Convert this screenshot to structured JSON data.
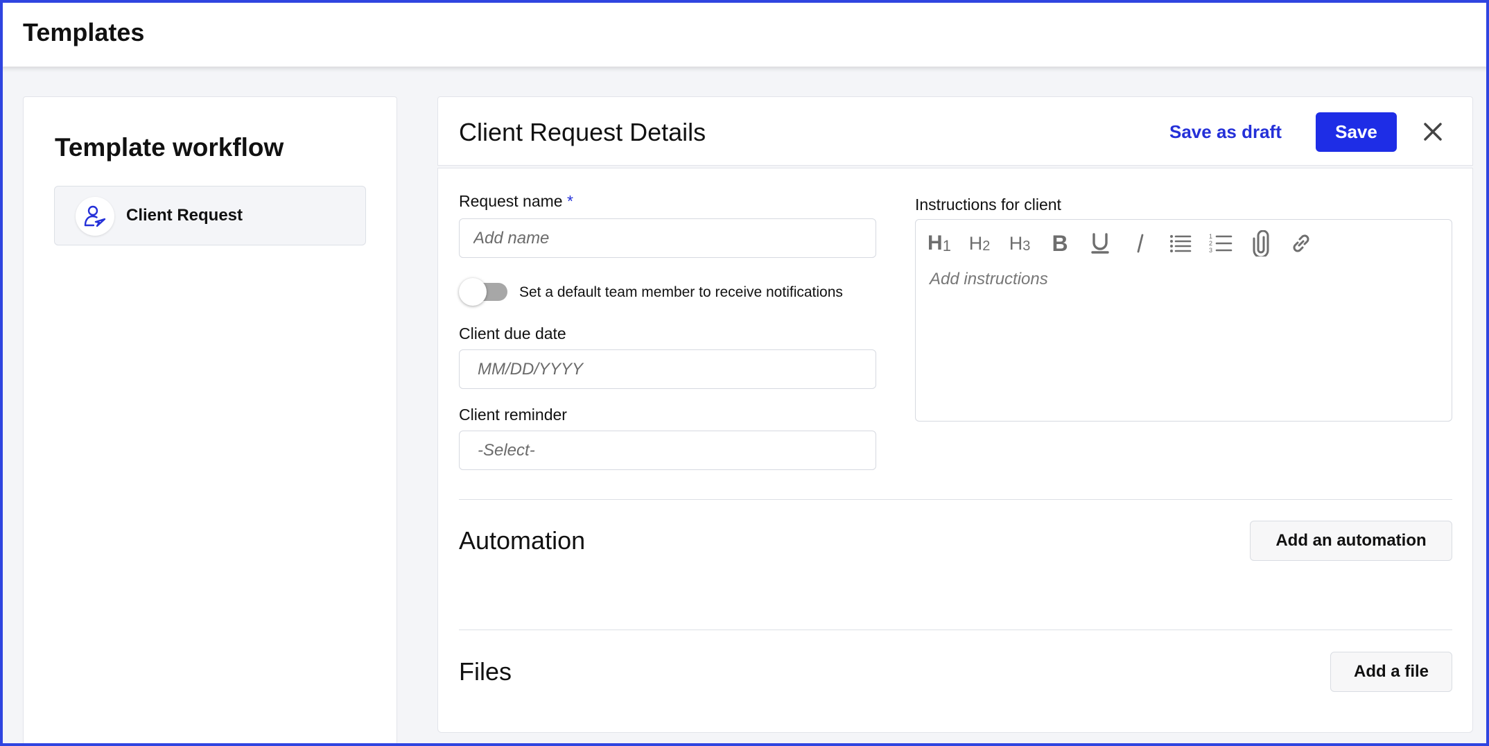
{
  "app": {
    "page_title": "Templates"
  },
  "sidebar": {
    "heading": "Template workflow",
    "items": [
      {
        "label": "Client Request",
        "icon": "user-send-icon"
      }
    ]
  },
  "detail": {
    "title": "Client Request Details",
    "save_draft_label": "Save as draft",
    "save_label": "Save",
    "close_icon": "close-icon"
  },
  "form": {
    "request_name_label": "Request name",
    "required_marker": "*",
    "request_name_placeholder": "Add name",
    "request_name_value": "",
    "notify_toggle_label": "Set a default team member to receive notifications",
    "notify_toggle_on": false,
    "due_date_label": "Client due date",
    "due_date_placeholder": "MM/DD/YYYY",
    "reminder_label": "Client reminder",
    "reminder_placeholder": "-Select-",
    "instructions_label": "Instructions for client",
    "instructions_placeholder": "Add instructions",
    "toolbar": [
      "heading-1-icon",
      "heading-2-icon",
      "heading-3-icon",
      "bold-icon",
      "underline-icon",
      "italic-icon",
      "bulleted-list-icon",
      "numbered-list-icon",
      "attachment-icon",
      "link-icon"
    ]
  },
  "automation": {
    "title": "Automation",
    "button_label": "Add an automation"
  },
  "files": {
    "title": "Files",
    "button_label": "Add a file"
  },
  "colors": {
    "accent": "#1e2de6",
    "link": "#2430d8",
    "frame": "#2f45e0"
  }
}
